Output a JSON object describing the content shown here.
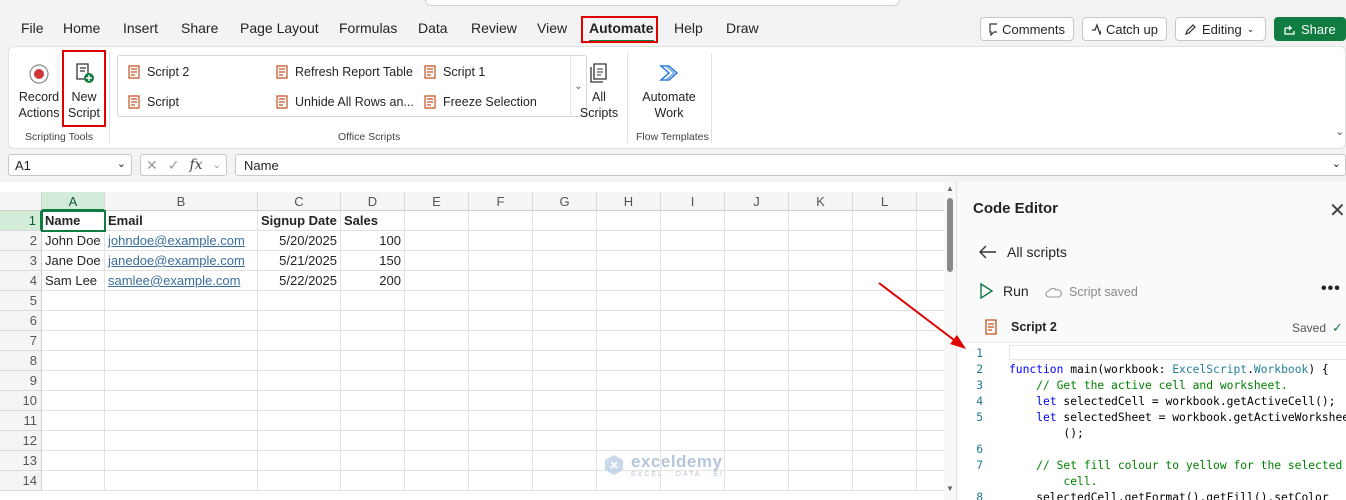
{
  "menubar": {
    "tabs": [
      "File",
      "Home",
      "Insert",
      "Share",
      "Page Layout",
      "Formulas",
      "Data",
      "Review",
      "View",
      "Automate",
      "Help",
      "Draw"
    ],
    "active_tab": "Automate",
    "comments_label": "Comments",
    "catchup_label": "Catch up",
    "editing_label": "Editing",
    "share_label": "Share"
  },
  "ribbon": {
    "record_actions": "Record Actions",
    "new_script_line1": "New",
    "new_script_line2": "Script",
    "record_line1": "Record",
    "record_line2": "Actions",
    "scripting_tools_label": "Scripting Tools",
    "gallery": [
      "Script 2",
      "Refresh Report Table",
      "Script 1",
      "Script",
      "Unhide All Rows an...",
      "Freeze Selection"
    ],
    "office_scripts_label": "Office Scripts",
    "all_scripts_line1": "All",
    "all_scripts_line2": "Scripts",
    "automate_work_line1": "Automate",
    "automate_work_line2": "Work",
    "flow_templates_label": "Flow Templates"
  },
  "formula_bar": {
    "name_box": "A1",
    "formula": "Name"
  },
  "sheet": {
    "columns": [
      "A",
      "B",
      "C",
      "D",
      "E",
      "F",
      "G",
      "H",
      "I",
      "J",
      "K",
      "L"
    ],
    "rows": [
      "1",
      "2",
      "3",
      "4",
      "5",
      "6",
      "7",
      "8",
      "9",
      "10",
      "11",
      "12",
      "13",
      "14"
    ],
    "header": [
      "Name",
      "Email",
      "Signup Date",
      "Sales"
    ],
    "data": [
      [
        "John Doe",
        "johndoe@example.com",
        "5/20/2025",
        "100"
      ],
      [
        "Jane Doe",
        "janedoe@example.com",
        "5/21/2025",
        "150"
      ],
      [
        "Sam Lee",
        "samlee@example.com",
        "5/22/2025",
        "200"
      ]
    ]
  },
  "code_editor": {
    "title": "Code Editor",
    "back_label": "All scripts",
    "run_label": "Run",
    "saved_status": "Script saved",
    "script_name": "Script 2",
    "saved_label": "Saved",
    "line_numbers": [
      "1",
      "2",
      "3",
      "4",
      "5",
      "6",
      "7",
      "8"
    ]
  },
  "watermark": {
    "brand": "exceldemy",
    "tagline": "EXCEL · DATA · BI"
  },
  "colors": {
    "accent_green": "#107c41",
    "highlight_red": "#e00000",
    "link_blue": "#3b6e9b"
  }
}
